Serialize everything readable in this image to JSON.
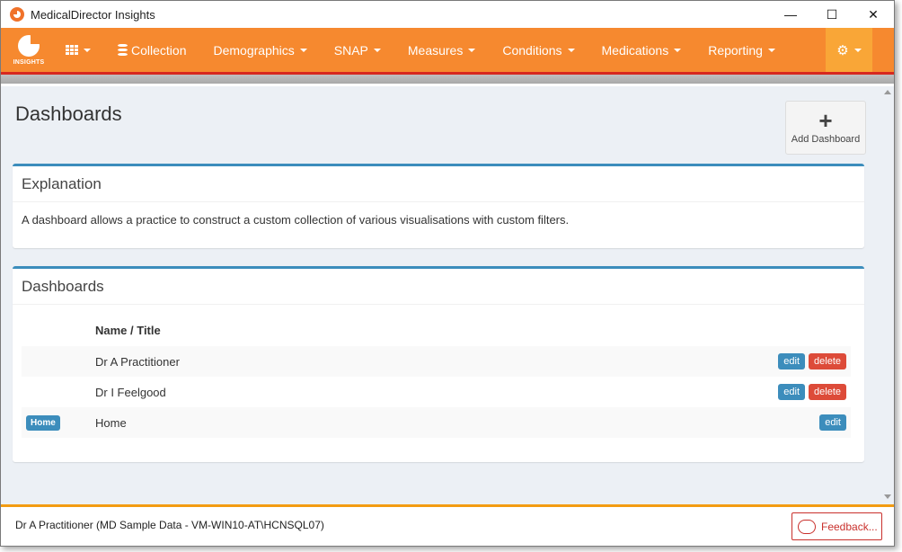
{
  "window": {
    "title": "MedicalDirector Insights",
    "controls": {
      "minimize": "—",
      "maximize": "☐",
      "close": "✕"
    }
  },
  "navbar": {
    "brand_label": "INSIGHTS",
    "items": [
      {
        "label": "Collection",
        "has_caret": false,
        "icon": "database-icon"
      },
      {
        "label": "Demographics",
        "has_caret": true
      },
      {
        "label": "SNAP",
        "has_caret": true
      },
      {
        "label": "Measures",
        "has_caret": true
      },
      {
        "label": "Conditions",
        "has_caret": true
      },
      {
        "label": "Medications",
        "has_caret": true
      },
      {
        "label": "Reporting",
        "has_caret": true
      }
    ],
    "colors": {
      "bar": "#f6892f",
      "accent": "#d7281f",
      "settings": "#f9a637"
    }
  },
  "page": {
    "title": "Dashboards",
    "add_button_label": "Add Dashboard",
    "add_button_icon": "+"
  },
  "explanation": {
    "title": "Explanation",
    "text": "A dashboard allows a practice to construct a custom collection of various visualisations with custom filters."
  },
  "dashboards": {
    "title": "Dashboards",
    "column_header": "Name / Title",
    "rows": [
      {
        "badge": "",
        "name": "Dr A Practitioner",
        "edit": "edit",
        "delete": "delete"
      },
      {
        "badge": "",
        "name": "Dr I Feelgood",
        "edit": "edit",
        "delete": "delete"
      },
      {
        "badge": "Home",
        "name": "Home",
        "edit": "edit",
        "delete": ""
      }
    ]
  },
  "footer": {
    "user_text": "Dr A Practitioner (MD Sample Data - VM-WIN10-AT\\HCNSQL07)",
    "feedback_label": "Feedback..."
  }
}
